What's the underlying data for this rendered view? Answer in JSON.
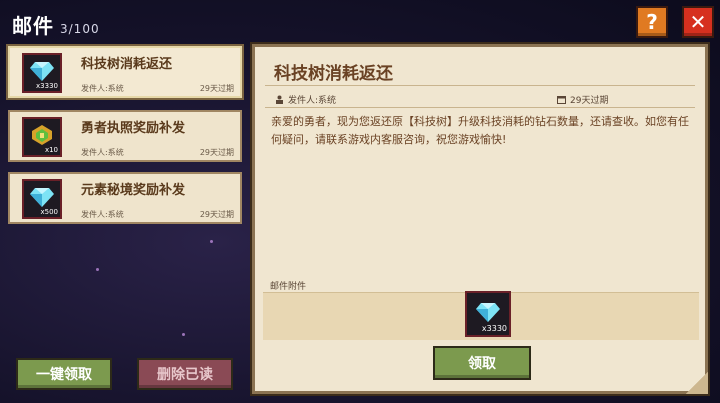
{
  "header": {
    "title": "邮件",
    "count": "3/100"
  },
  "mails": [
    {
      "title": "科技树消耗返还",
      "sender": "发件人:系统",
      "expire": "29天过期",
      "qty": "x3330",
      "icon": "diamond-icon"
    },
    {
      "title": "勇者执照奖励补发",
      "sender": "发件人:系统",
      "expire": "29天过期",
      "qty": "x10",
      "icon": "license-badge-icon"
    },
    {
      "title": "元素秘境奖励补发",
      "sender": "发件人:系统",
      "expire": "29天过期",
      "qty": "x500",
      "icon": "diamond-icon"
    }
  ],
  "buttons": {
    "claim_all": "一键领取",
    "delete_read": "删除已读",
    "claim": "领取",
    "help": "?",
    "close": "✕"
  },
  "detail": {
    "title": "科技树消耗返还",
    "sender": "发件人:系统",
    "expire": "29天过期",
    "body": "亲爱的勇者，现为您返还原【科技树】升级科技消耗的钻石数量，还请查收。如您有任何疑问，请联系游戏内客服咨询，祝您游戏愉快!",
    "attachment_label": "邮件附件",
    "attachment_qty": "x3330",
    "attachment_icon": "diamond-icon"
  },
  "colors": {
    "accent_green": "#7c9a4e",
    "close_red": "#d6301f",
    "help_orange": "#e07a22"
  }
}
